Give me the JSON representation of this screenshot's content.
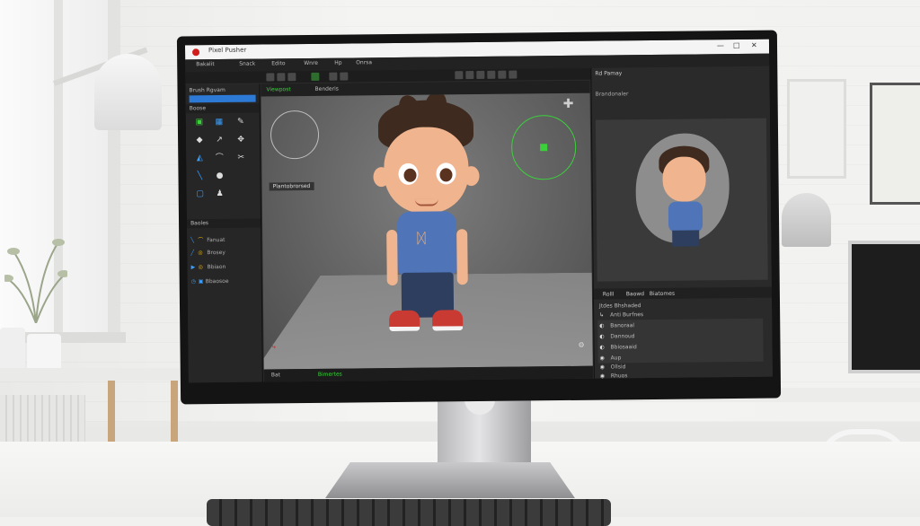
{
  "window": {
    "title": "Pixel Pusher",
    "controls": [
      "—",
      "□",
      "✕"
    ]
  },
  "menubar": {
    "items": [
      "Bakalit",
      "Snack",
      "Edito",
      "Wnre",
      "Hp",
      "Onrsa"
    ]
  },
  "left_panel": {
    "header": "Brush Rgvam",
    "tools_header": "Boose",
    "layers_header": "Baoles",
    "rows": [
      {
        "label": "Fanuat"
      },
      {
        "label": "Brosey"
      },
      {
        "label": "Bbiaon"
      },
      {
        "label": "Bbaosoe"
      }
    ]
  },
  "viewport": {
    "tabs": [
      "Viewpost",
      "Benderis"
    ],
    "object_label": "Plantobrorsed",
    "status_left": "Bat",
    "status_mid": "Bimertes"
  },
  "right_panel": {
    "title": "Rd Pamay",
    "subtitle": "Brandonaler",
    "tabs": [
      "Rolll",
      "Baowd",
      "Biatomes"
    ],
    "layer_header": "Jtdes Bhshaded",
    "layer_items": [
      "Anti Burfnes",
      "Banoraal",
      "Dannoud",
      "Bbiosaaid"
    ],
    "bottom_items": [
      "Aup",
      "Ollsid",
      "Rhuos"
    ]
  },
  "colors": {
    "accent": "#2d7ad6",
    "app_logo": "#d21d1d",
    "gizmo_green": "#3bd13b"
  }
}
